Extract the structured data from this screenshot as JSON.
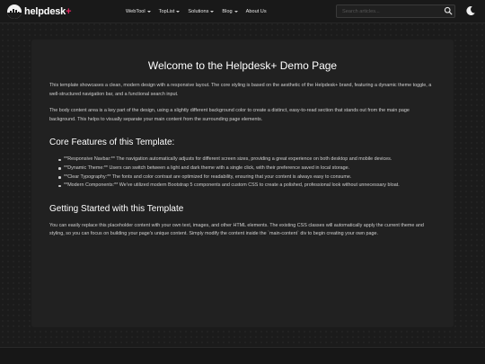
{
  "brand": {
    "name": "helpdesk",
    "plus": "+"
  },
  "nav": {
    "items": [
      {
        "label": "WebTool",
        "has_dropdown": true
      },
      {
        "label": "TopList",
        "has_dropdown": true
      },
      {
        "label": "Solutions",
        "has_dropdown": true
      },
      {
        "label": "Blog",
        "has_dropdown": true
      },
      {
        "label": "About Us",
        "has_dropdown": false
      }
    ]
  },
  "search": {
    "placeholder": "Search articles...",
    "value": ""
  },
  "theme": {
    "mode": "dark",
    "toggle_icon": "moon-icon"
  },
  "content": {
    "title": "Welcome to the Helpdesk+ Demo Page",
    "intro_1": "This template showcases a clean, modern design with a responsive layout. The core styling is based on the aesthetic of the Helpdesk+ brand, featuring a dynamic theme toggle, a well-structured navigation bar, and a functional search input.",
    "intro_2": "The body content area is a key part of the design, using a slightly different background color to create a distinct, easy-to-read section that stands out from the main page background. This helps to visually separate your main content from the surrounding page elements.",
    "features_heading": "Core Features of this Template:",
    "features": [
      "**Responsive Navbar:** The navigation automatically adjusts for different screen sizes, providing a great experience on both desktop and mobile devices.",
      "**Dynamic Theme:** Users can switch between a light and dark theme with a single click, with their preference saved in local storage.",
      "**Clear Typography:** The fonts and color contrast are optimized for readability, ensuring that your content is always easy to consume.",
      "**Modern Components:** We've utilized modern Bootstrap 5 components and custom CSS to create a polished, professional look without unnecessary bloat."
    ],
    "getting_started_heading": "Getting Started with this Template",
    "getting_started_text": "You can easily replace this placeholder content with your own text, images, and other HTML elements. The existing CSS classes will automatically apply the current theme and styling, so you can focus on building your page's unique content. Simply modify the content inside the `main-content` div to begin creating your own page."
  },
  "colors": {
    "page_bg": "#1b1b1b",
    "content_bg": "#212121",
    "accent": "#e0245e",
    "text": "#cfcfcf",
    "heading": "#ffffff"
  }
}
